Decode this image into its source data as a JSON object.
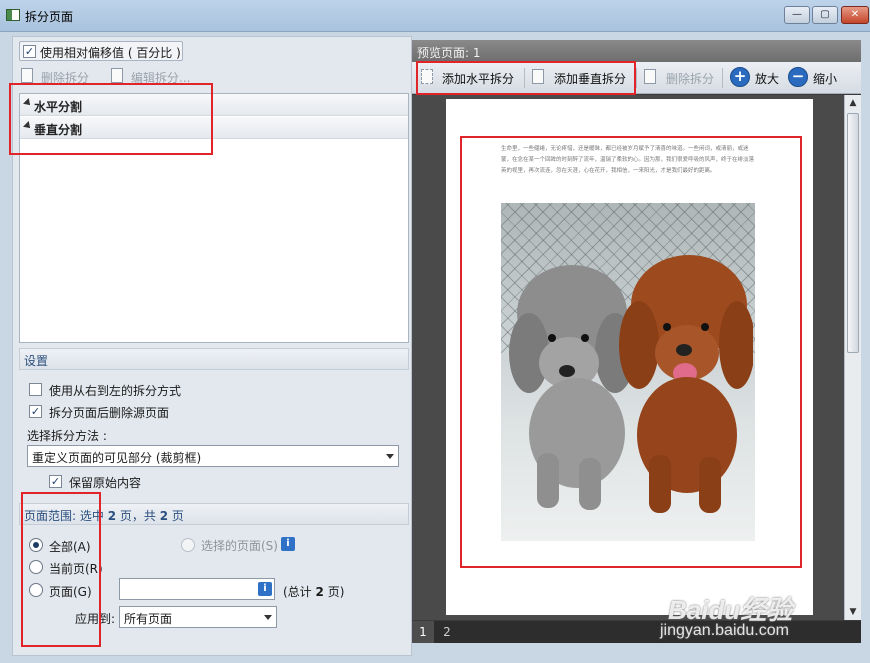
{
  "window": {
    "title": "拆分页面",
    "min_glyph": "—",
    "max_glyph": "▢",
    "close_glyph": "✕"
  },
  "left": {
    "use_relative_offset_label": "使用相对偏移值 ( 百分比 )",
    "use_relative_offset_checked": true,
    "toolbar": {
      "delete_split": "删除拆分",
      "edit_split": "编辑拆分..."
    },
    "split_list": [
      {
        "label": "水平分割"
      },
      {
        "label": "垂直分割"
      }
    ],
    "settings": {
      "header": "设置",
      "rtl_label": "使用从右到左的拆分方式",
      "rtl_checked": false,
      "delete_source_label": "拆分页面后删除源页面",
      "delete_source_checked": true,
      "method_label": "选择拆分方法 :",
      "method_value": "重定义页面的可见部分 (裁剪框)",
      "keep_original_label": "保留原始内容",
      "keep_original_checked": true
    },
    "page_range": {
      "header_prefix": "页面范围: 选中",
      "selected_count": "2",
      "header_mid": "页，共",
      "total_count": "2",
      "header_suffix": "页",
      "all_label": "全部(A)",
      "current_label": "当前页(R)",
      "pages_label": "页面(G)",
      "selected_pages_label": "选择的页面(S)",
      "pages_input_value": "",
      "total_prefix": "(总计",
      "total_pages": "2",
      "total_suffix": "页)",
      "apply_to_label": "应用到:",
      "apply_to_value": "所有页面",
      "selected_option": "all"
    }
  },
  "right": {
    "preview_header": "预览页面: 1",
    "toolbar": {
      "add_horizontal": "添加水平拆分",
      "add_vertical": "添加垂直拆分",
      "delete_split": "删除拆分",
      "zoom_in": "放大",
      "zoom_out": "缩小"
    },
    "page_text": "生命里，一些缱绻，无论疼惜，还是暖昧，都已经被岁月赋予了清喜的味道。一些闲词，或清丽，或迷蒙，在念在某一个回眸的时刻醉了流年，温瑞了柔软的心。因为那，我们很爱呼吸的风声，终于在绯淡落英的视里，再次流连，忽在天涯，心在花开，我相信，一来阳光，才是我们最好的距离。",
    "pages": [
      "1",
      "2"
    ],
    "active_page": "1"
  },
  "watermark": {
    "brand": "Baidu经验",
    "site": "jingyan.baidu.com"
  },
  "colors": {
    "annotation_red": "#e0242a",
    "accent_blue": "#2a6bbf"
  }
}
